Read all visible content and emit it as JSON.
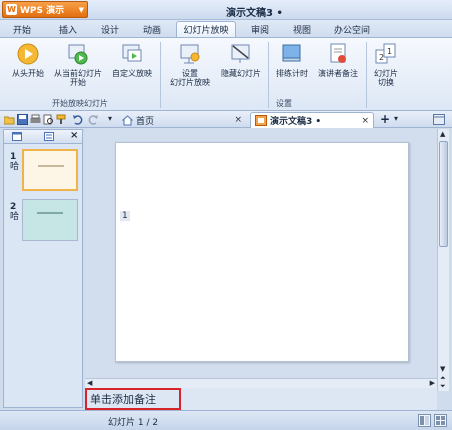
{
  "app": {
    "logo_text": "W",
    "menu_label": "WPS 演示",
    "document_title": "演示文稿3 •"
  },
  "menu_tabs": [
    "开始",
    "插入",
    "设计",
    "动画",
    "幻灯片放映",
    "审阅",
    "视图",
    "办公空间"
  ],
  "active_menu_tab": "幻灯片放映",
  "ribbon": {
    "buttons": [
      {
        "label_1": "从头开始",
        "label_2": "",
        "icon": "play-icon"
      },
      {
        "label_1": "从当前幻灯片",
        "label_2": "开始",
        "icon": "play-from-current-icon"
      },
      {
        "label_1": "自定义放映",
        "label_2": "",
        "icon": "custom-show-icon"
      },
      {
        "label_1": "设置",
        "label_2": "幻灯片放映",
        "icon": "setup-show-icon"
      },
      {
        "label_1": "隐藏幻灯片",
        "label_2": "",
        "icon": "hide-slide-icon"
      },
      {
        "label_1": "排练计时",
        "label_2": "",
        "icon": "rehearse-timing-icon"
      },
      {
        "label_1": "演讲者备注",
        "label_2": "",
        "icon": "speaker-notes-icon"
      },
      {
        "label_1": "幻灯片",
        "label_2": "切换",
        "icon": "slide-transition-icon"
      }
    ],
    "group_start_label": "开始放映幻灯片",
    "group_setup_label": "设置"
  },
  "doc_tabs": [
    {
      "label": "首页",
      "close": "×"
    },
    {
      "label": "演示文稿3 •",
      "close": "×"
    }
  ],
  "new_tab_label": "+",
  "slides": [
    {
      "number": "1",
      "icon": "哈"
    },
    {
      "number": "2",
      "icon": "哈"
    }
  ],
  "slide_placeholder_number": "1",
  "notes_placeholder": "单击添加备注",
  "status": {
    "slide_counter": "幻灯片 1 / 2"
  },
  "colors": {
    "accent_orange": "#e36f0f",
    "notes_highlight": "#d9232a",
    "slide1_thumb_bg": "#fdf5e6",
    "slide2_thumb_bg": "#c5e6e4"
  }
}
